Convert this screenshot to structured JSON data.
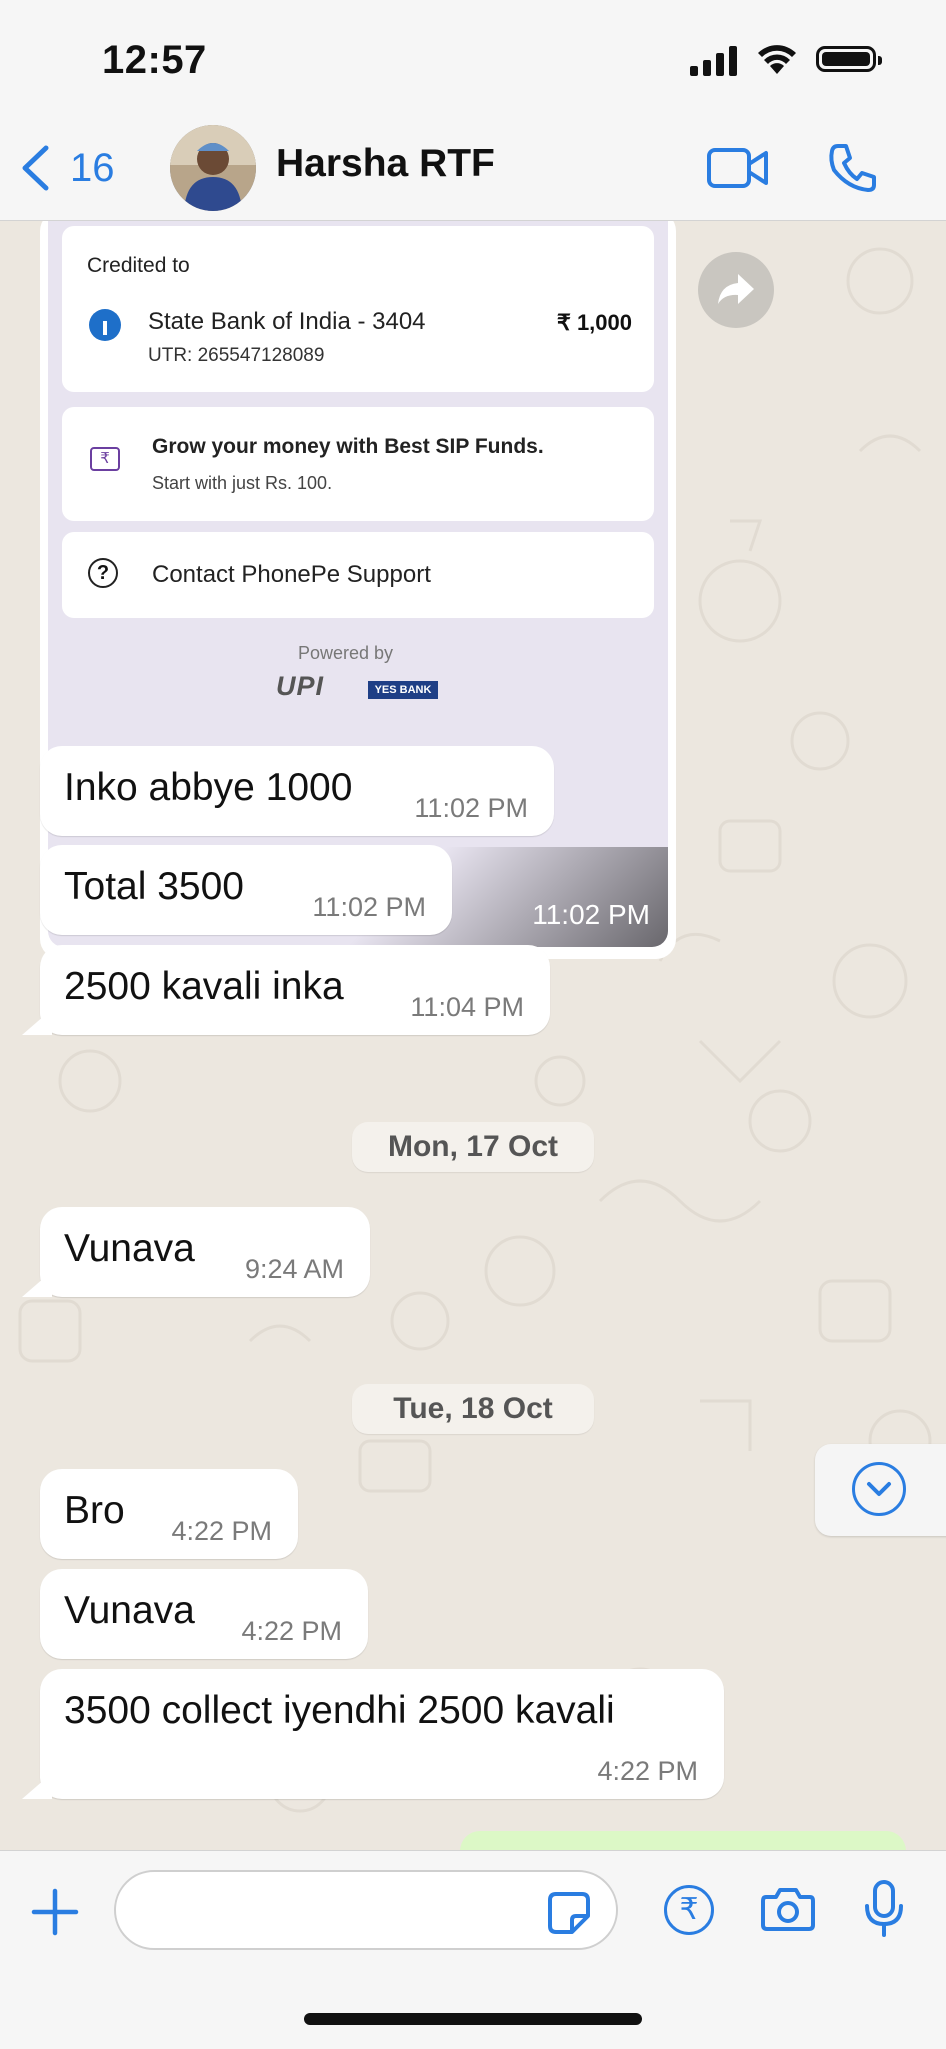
{
  "status_bar": {
    "time": "12:57"
  },
  "header": {
    "back_count": "16",
    "contact_name": "Harsha RTF"
  },
  "receipt": {
    "credited_label": "Credited to",
    "bank": "State Bank of India - 3404",
    "utr": "UTR: 265547128089",
    "amount": "₹ 1,000",
    "sip_title": "Grow your money with Best SIP Funds.",
    "sip_subtitle": "Start with just Rs. 100.",
    "sip_icon_glyph": "₹",
    "support": "Contact PhonePe Support",
    "powered_by": "Powered by",
    "upi_logo": "UPI",
    "yes_logo": "YES BANK",
    "time": "11:02 PM"
  },
  "messages": [
    {
      "text": "Inko abbye 1000",
      "time": "11:02 PM"
    },
    {
      "text": "Total 3500",
      "time": "11:02 PM"
    },
    {
      "text": "2500 kavali inka",
      "time": "11:04 PM"
    },
    {
      "text": "Vunava",
      "time": "9:24 AM"
    },
    {
      "text": "Bro",
      "time": "4:22 PM"
    },
    {
      "text": "Vunava",
      "time": "4:22 PM"
    },
    {
      "text": "3500 collect iyendhi 2500 kavali",
      "time": "4:22 PM"
    }
  ],
  "dates": [
    "Mon, 17 Oct",
    "Tue, 18 Oct"
  ],
  "input": {
    "placeholder": "",
    "rupee_glyph": "₹"
  },
  "colors": {
    "accent": "#2a7de1",
    "chat_bg": "#ece7df",
    "bubble_in": "#ffffff",
    "bubble_out": "#dcf8c6"
  }
}
